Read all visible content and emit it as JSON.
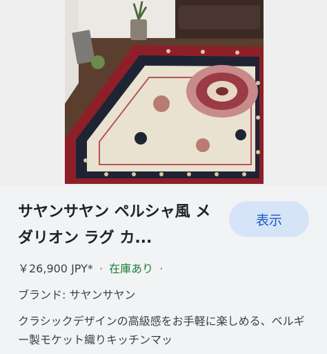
{
  "product": {
    "image_alt": "ペルシャ風 メダリオン ラグ",
    "title": "サヤンサヤン ペルシャ風 メダリオン ラグ カ...",
    "show_button": "表示",
    "price": "￥26,900 JPY*",
    "stock": "在庫あり",
    "separator": "·",
    "brand": "ブランド: サヤンサヤン",
    "description": "クラシックデザインの高級感をお手軽に楽しめる、ベルギー製モケット織りキッチンマッ"
  },
  "colors": {
    "rug_red": "#8e1f28",
    "rug_navy": "#1f2435",
    "rug_cream": "#e9e2d0",
    "stock_green": "#188038",
    "button_bg": "#d6e4f8",
    "button_text": "#1a55c8"
  }
}
